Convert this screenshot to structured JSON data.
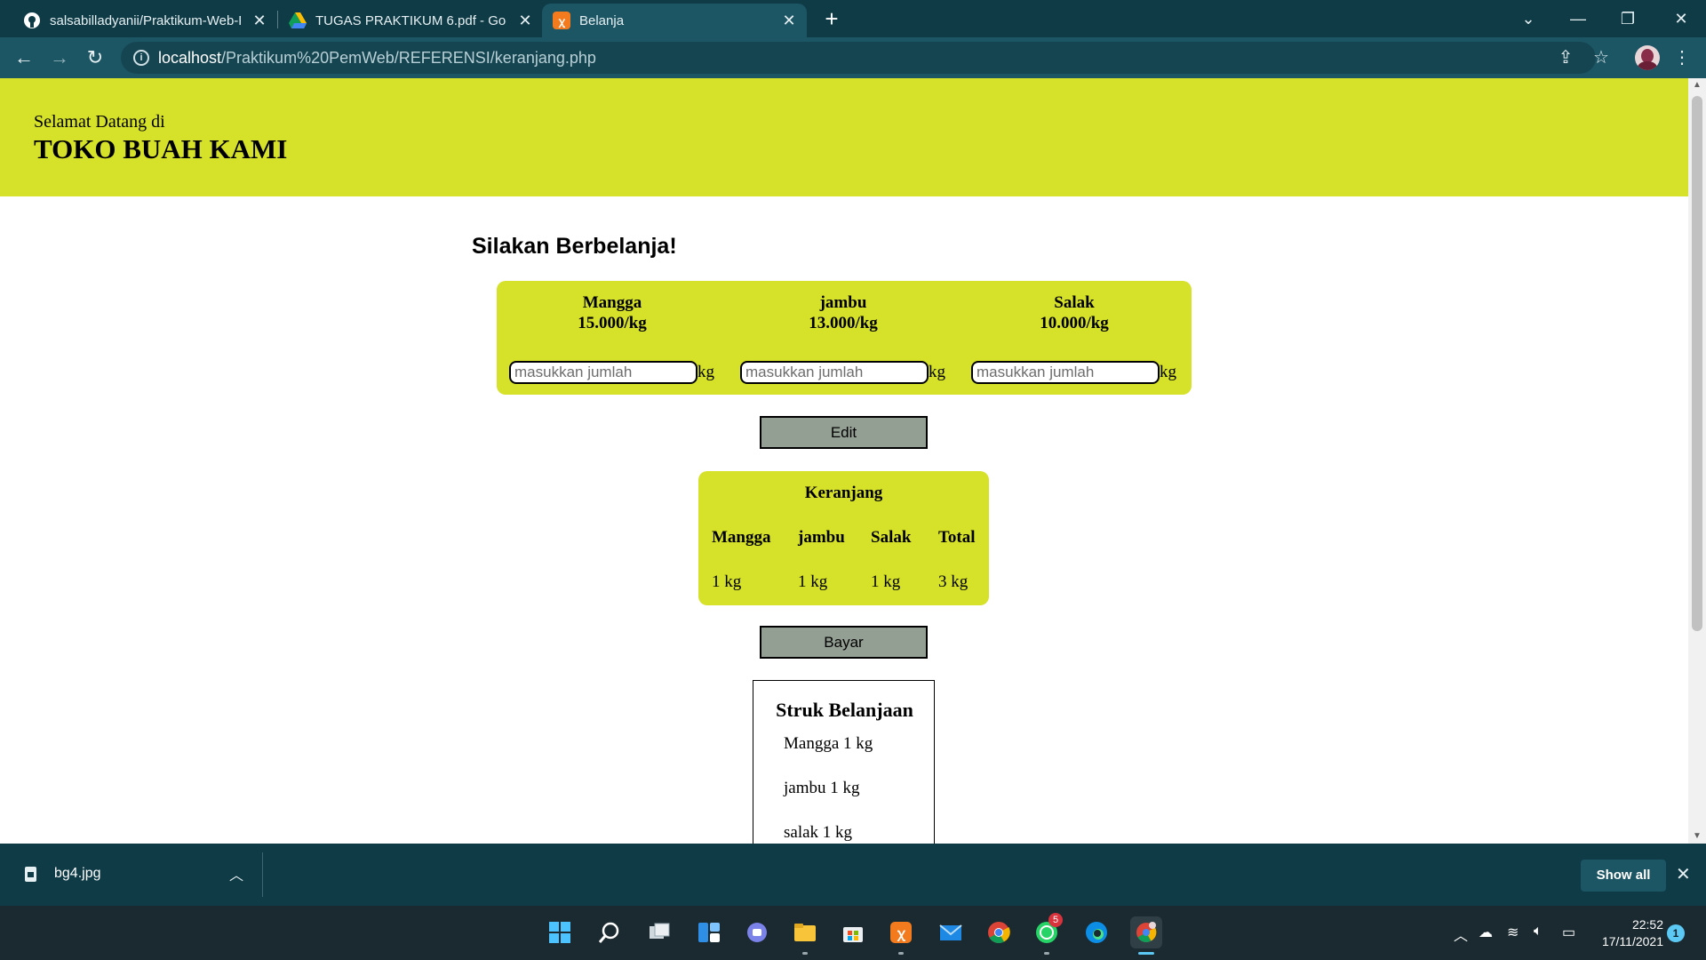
{
  "browser": {
    "tabs": [
      {
        "title": "salsabilladyanii/Praktikum-Web-P",
        "icon": "github-icon"
      },
      {
        "title": "TUGAS PRAKTIKUM 6.pdf - Goog",
        "icon": "google-drive-icon"
      },
      {
        "title": "Belanja",
        "icon": "xampp-icon"
      }
    ],
    "url_host": "localhost",
    "url_path": "/Praktikum%20PemWeb/REFERENSI/keranjang.php"
  },
  "page": {
    "header": {
      "welcome": "Selamat Datang di",
      "shop_name": "TOKO BUAH KAMI"
    },
    "title": "Silakan Berbelanja!",
    "fruits": [
      {
        "name": "Mangga",
        "price": "15.000/kg",
        "placeholder": "masukkan jumlah",
        "unit": "kg"
      },
      {
        "name": "jambu",
        "price": "13.000/kg",
        "placeholder": "masukkan jumlah",
        "unit": "kg"
      },
      {
        "name": "Salak",
        "price": "10.000/kg",
        "placeholder": "masukkan jumlah",
        "unit": "kg"
      }
    ],
    "edit_button": "Edit",
    "cart": {
      "title": "Keranjang",
      "headers": [
        "Mangga",
        "jambu",
        "Salak",
        "Total"
      ],
      "values": [
        "1 kg",
        "1 kg",
        "1 kg",
        "3 kg"
      ]
    },
    "pay_button": "Bayar",
    "receipt": {
      "title": "Struk Belanjaan",
      "items": [
        "Mangga 1 kg",
        "jambu 1 kg",
        "salak 1 kg"
      ]
    }
  },
  "downloads": {
    "file": "bg4.jpg",
    "show_all": "Show all"
  },
  "taskbar": {
    "whatsapp_badge": "5",
    "time": "22:52",
    "date": "17/11/2021",
    "notifications": "1"
  },
  "colors": {
    "accent_yellow": "#d6e129",
    "button_gray": "#949f94",
    "chrome_dark": "#0f3b47",
    "chrome_mid": "#1c5563"
  }
}
